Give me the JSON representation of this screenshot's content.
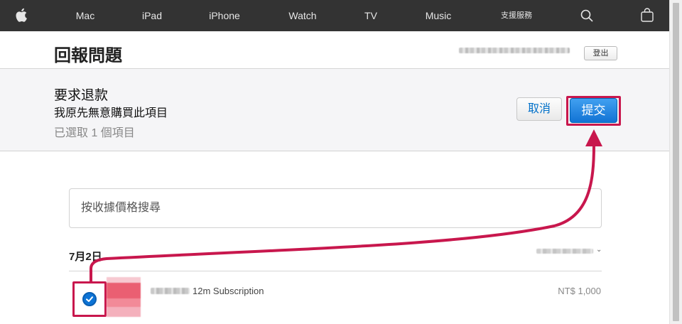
{
  "nav": {
    "items": [
      "Mac",
      "iPad",
      "iPhone",
      "Watch",
      "TV",
      "Music",
      "支援服務"
    ],
    "icons": [
      "apple-logo-icon",
      "search-icon",
      "bag-icon"
    ]
  },
  "header": {
    "title": "回報問題",
    "signout_label": "登出"
  },
  "request": {
    "title": "要求退款",
    "reason": "我原先無意購買此項目",
    "selected_count": "已選取 1 個項目",
    "cancel_label": "取消",
    "submit_label": "提交"
  },
  "search": {
    "placeholder": "按收據價格搜尋"
  },
  "purchases": {
    "date": "7月2日",
    "items": [
      {
        "title": "12m Subscription",
        "price": "NT$ 1,000",
        "selected": true
      }
    ]
  },
  "colors": {
    "nav_bg": "#333333",
    "accent_blue": "#0070c9",
    "annotation_red": "#c8174d"
  }
}
